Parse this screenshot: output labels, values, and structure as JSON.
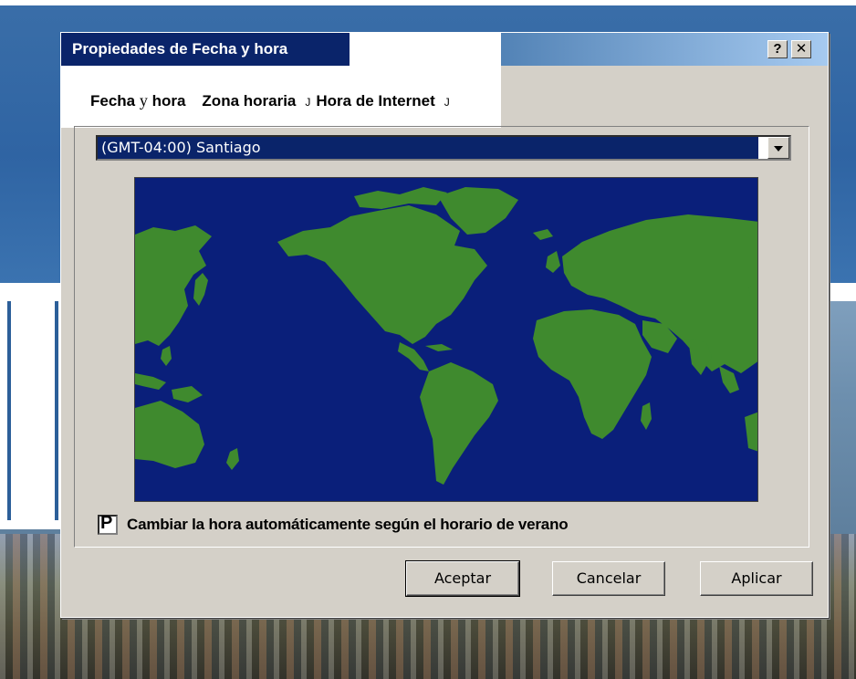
{
  "window": {
    "title": "Propiedades  de Fecha y hora",
    "help_btn": "?",
    "close_btn": "✕"
  },
  "tabs": [
    {
      "label_a": "Fecha ",
      "label_y": "y",
      "label_b": " hora"
    },
    {
      "label": "Zona horaria"
    },
    {
      "label": "Hora de Internet"
    }
  ],
  "tab_separator": "J",
  "timezone": {
    "selected": "(GMT-04:00) Santiago"
  },
  "dst_checkbox": {
    "checked": true,
    "mark": "P",
    "label": "Cambiar la hora automáticamente según el horario de verano"
  },
  "buttons": {
    "ok": "Aceptar",
    "cancel": "Cancelar",
    "apply": "Aplicar"
  },
  "colors": {
    "ocean": "#0a1f7a",
    "land": "#3f8a2e",
    "titlebar": "#0a246a",
    "dialog": "#d4d0c8"
  },
  "icons": {
    "dropdown": "chevron-down-icon",
    "close": "close-icon",
    "help": "help-icon"
  }
}
